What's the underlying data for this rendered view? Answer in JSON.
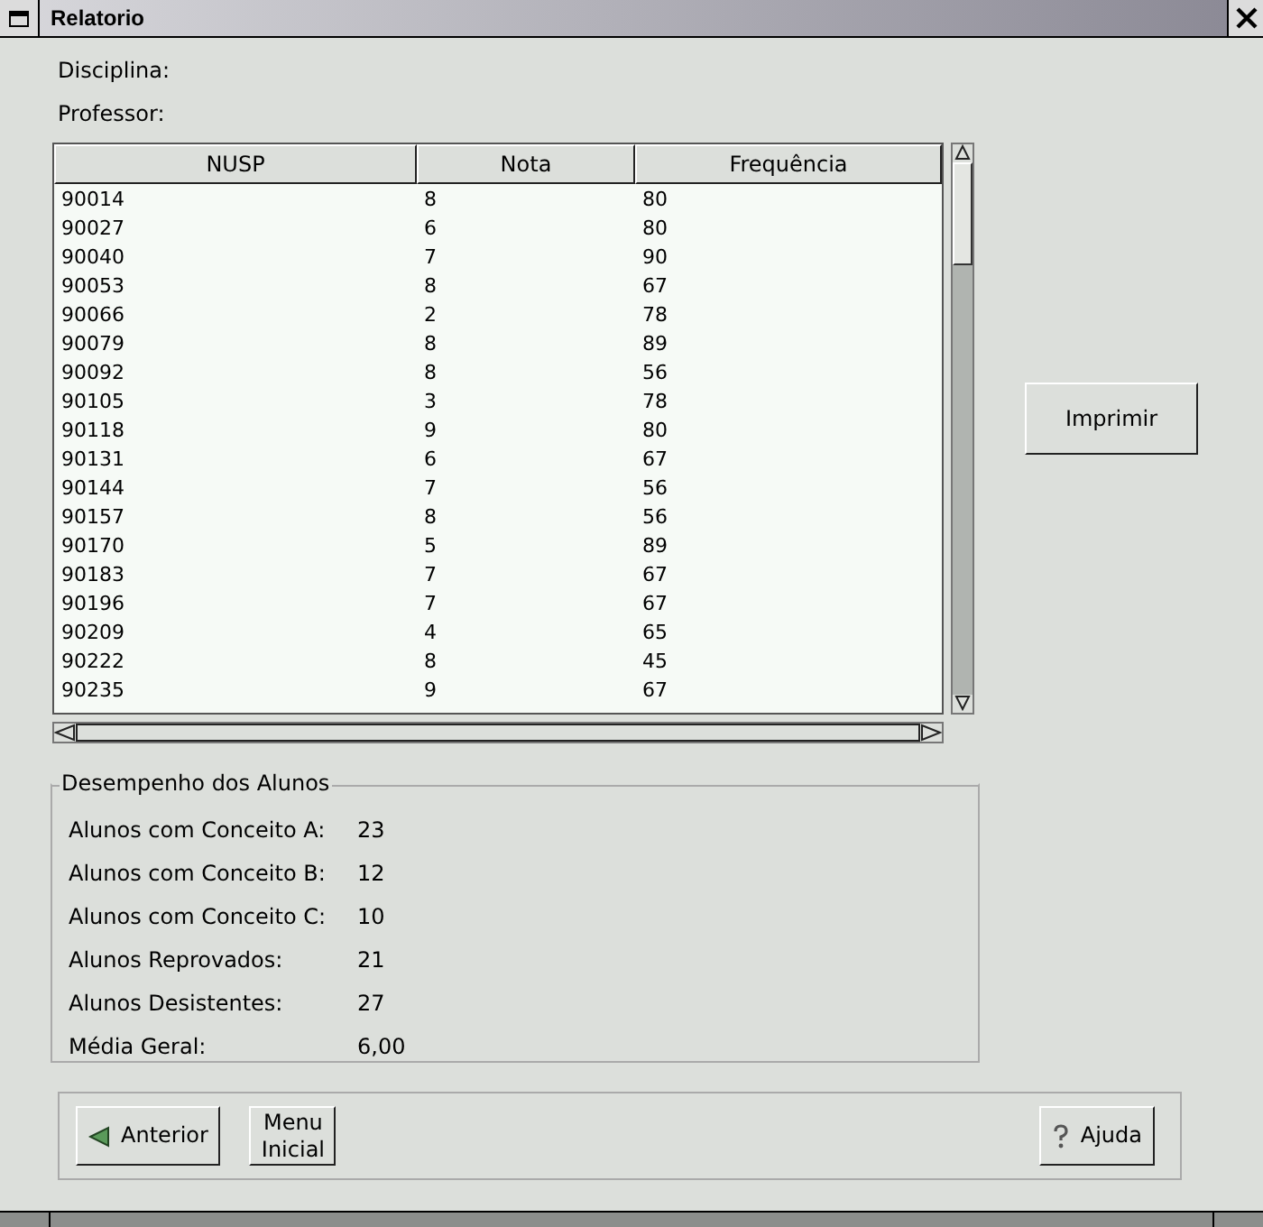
{
  "window": {
    "title": "Relatorio"
  },
  "fields": [
    {
      "label": "Disciplina:"
    },
    {
      "label": "Professor:"
    }
  ],
  "table": {
    "columns": [
      "NUSP",
      "Nota",
      "Frequência"
    ],
    "rows": [
      [
        "90014",
        "8",
        "80"
      ],
      [
        "90027",
        "6",
        "80"
      ],
      [
        "90040",
        "7",
        "90"
      ],
      [
        "90053",
        "8",
        "67"
      ],
      [
        "90066",
        "2",
        "78"
      ],
      [
        "90079",
        "8",
        "89"
      ],
      [
        "90092",
        "8",
        "56"
      ],
      [
        "90105",
        "3",
        "78"
      ],
      [
        "90118",
        "9",
        "80"
      ],
      [
        "90131",
        "6",
        "67"
      ],
      [
        "90144",
        "7",
        "56"
      ],
      [
        "90157",
        "8",
        "56"
      ],
      [
        "90170",
        "5",
        "89"
      ],
      [
        "90183",
        "7",
        "67"
      ],
      [
        "90196",
        "7",
        "67"
      ],
      [
        "90209",
        "4",
        "65"
      ],
      [
        "90222",
        "8",
        "45"
      ],
      [
        "90235",
        "9",
        "67"
      ]
    ]
  },
  "print_button": "Imprimir",
  "summary": {
    "title": "Desempenho dos Alunos",
    "rows": [
      {
        "label": "Alunos com Conceito A:",
        "value": "23"
      },
      {
        "label": "Alunos com Conceito B:",
        "value": "12"
      },
      {
        "label": "Alunos com Conceito C:",
        "value": "10"
      },
      {
        "label": "Alunos Reprovados:",
        "value": "21"
      },
      {
        "label": "Alunos Desistentes:",
        "value": "27"
      },
      {
        "label": "Média Geral:",
        "value": "6,00"
      }
    ]
  },
  "buttons": [
    {
      "kind": "back",
      "label": "Anterior"
    },
    {
      "kind": "plain",
      "label": "Menu Inicial"
    },
    {
      "kind": "help",
      "label": "Ajuda"
    }
  ]
}
